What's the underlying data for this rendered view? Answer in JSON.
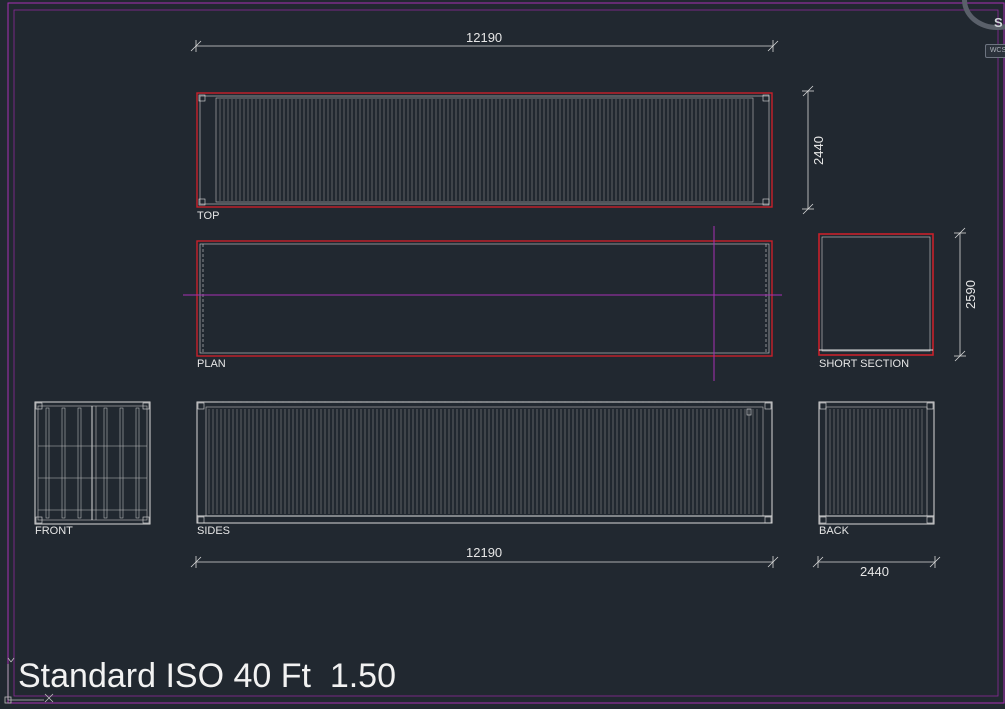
{
  "drawing": {
    "title": "Standard ISO 40 Ft  1.50",
    "view_labels": {
      "top": "TOP",
      "plan": "PLAN",
      "front": "FRONT",
      "sides": "SIDES",
      "short_section": "SHORT SECTION",
      "back": "BACK"
    },
    "dimensions": {
      "top_length": "12190",
      "top_width": "2440",
      "section_height": "2590",
      "sides_length": "12190",
      "back_width": "2440"
    }
  },
  "navigation": {
    "wcs_label": "WCS",
    "viewcube_letter": "S"
  },
  "colors": {
    "background": "#212830",
    "line": "#d9d9d9",
    "accent_red": "#c8202a",
    "boundary_magenta": "#b02ab8",
    "text": "#e6e6e6"
  }
}
